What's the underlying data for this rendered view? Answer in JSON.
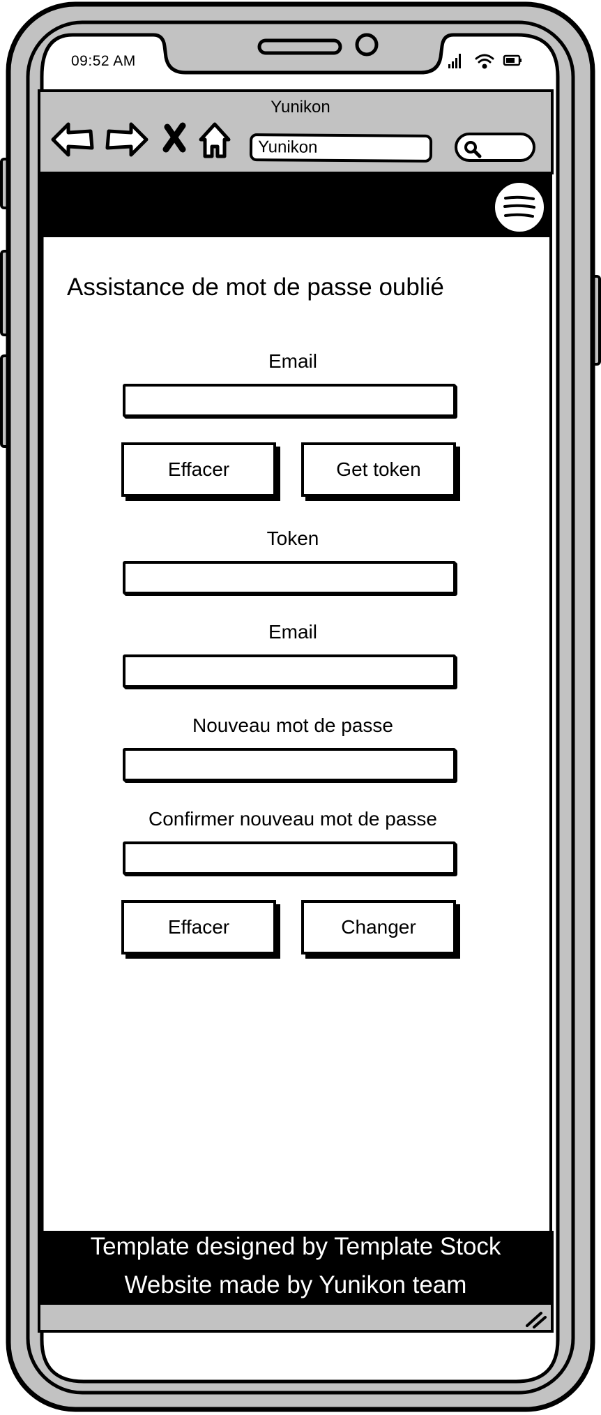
{
  "status_bar": {
    "time": "09:52 AM",
    "icons": [
      "signal-icon",
      "wifi-icon",
      "battery-icon"
    ]
  },
  "browser": {
    "title": "Yunikon",
    "url_value": "Yunikon",
    "nav_icons": [
      "back-arrow-icon",
      "forward-arrow-icon",
      "close-icon",
      "home-icon"
    ],
    "search_icon": "search-icon"
  },
  "header": {
    "menu_icon": "hamburger-menu-icon"
  },
  "page": {
    "title": "Assistance de mot de passe oublié",
    "request": {
      "email_label": "Email",
      "email_value": "",
      "clear_label": "Effacer",
      "get_token_label": "Get token"
    },
    "reset": {
      "token_label": "Token",
      "token_value": "",
      "email_label": "Email",
      "email_value": "",
      "new_password_label": "Nouveau mot de passe",
      "new_password_value": "",
      "confirm_password_label": "Confirmer nouveau mot de passe",
      "confirm_password_value": "",
      "clear_label": "Effacer",
      "change_label": "Changer"
    }
  },
  "footer": {
    "line1": "Template designed by Template Stock",
    "line2": "Website made by Yunikon team"
  },
  "colors": {
    "frame_gray": "#c2c2c2",
    "ink": "#000000",
    "paper": "#ffffff"
  }
}
